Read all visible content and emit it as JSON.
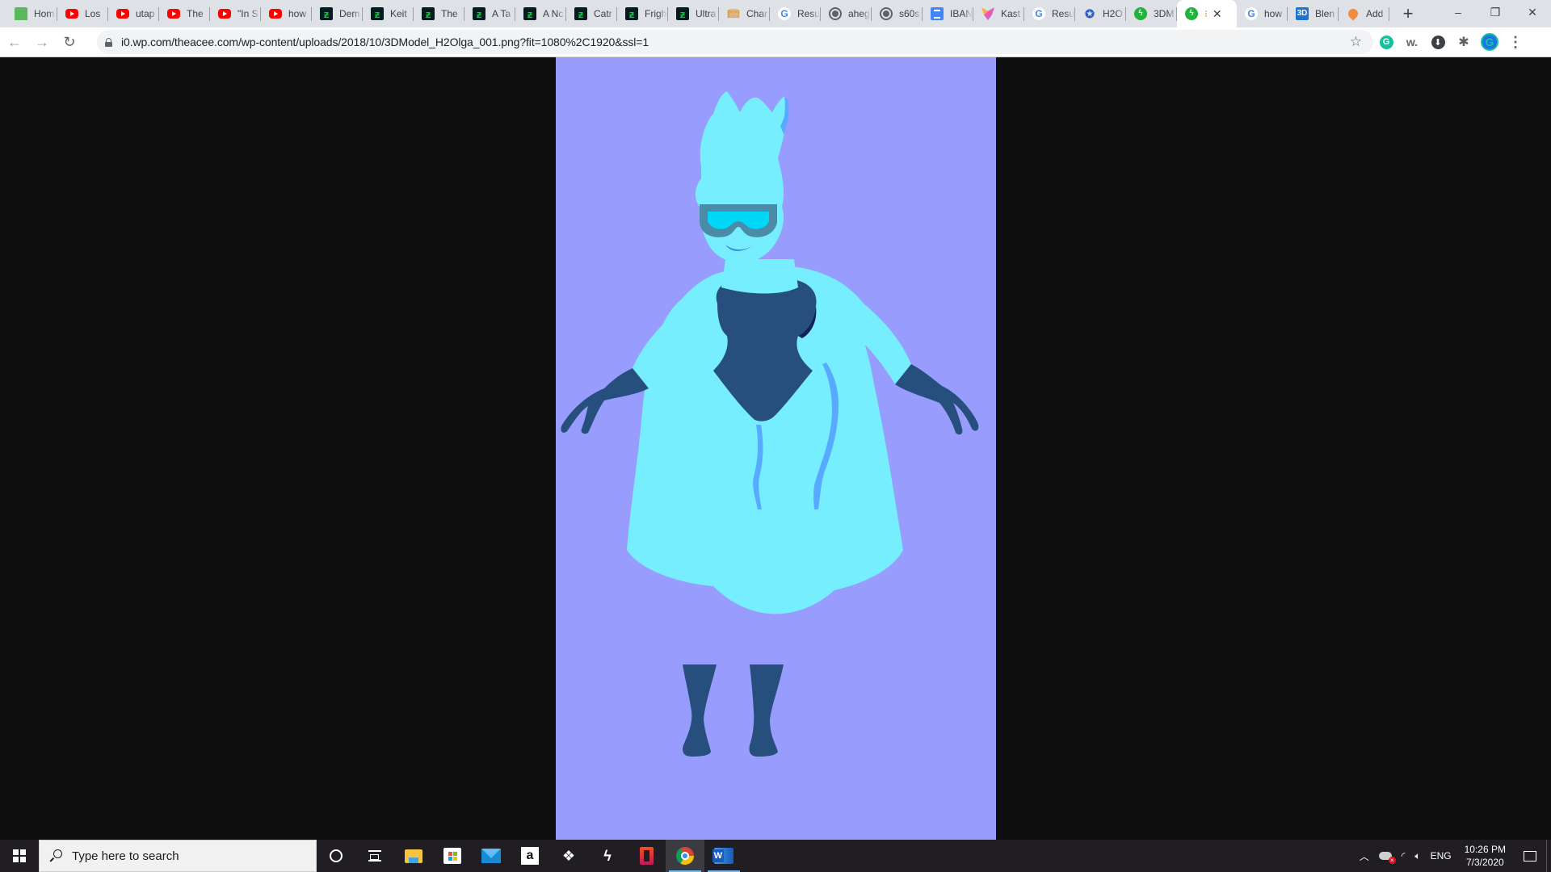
{
  "browser": {
    "tabs": [
      {
        "favicon": "home-icon",
        "title": "Hom"
      },
      {
        "favicon": "youtube-icon",
        "title": "Los"
      },
      {
        "favicon": "youtube-icon",
        "title": "utap"
      },
      {
        "favicon": "youtube-icon",
        "title": "The"
      },
      {
        "favicon": "youtube-icon",
        "title": "\"In S"
      },
      {
        "favicon": "youtube-icon",
        "title": "how"
      },
      {
        "favicon": "deviantart-icon",
        "title": "Dem"
      },
      {
        "favicon": "deviantart-icon",
        "title": "Keit"
      },
      {
        "favicon": "deviantart-icon",
        "title": "The"
      },
      {
        "favicon": "deviantart-icon",
        "title": "A Ta"
      },
      {
        "favicon": "deviantart-icon",
        "title": "A Nc"
      },
      {
        "favicon": "deviantart-icon",
        "title": "Catr"
      },
      {
        "favicon": "deviantart-icon",
        "title": "Frigh"
      },
      {
        "favicon": "deviantart-icon",
        "title": "Ultra"
      },
      {
        "favicon": "book-icon",
        "title": "Char"
      },
      {
        "favicon": "google-icon",
        "title": "Resu"
      },
      {
        "favicon": "globe-icon",
        "title": "aheg"
      },
      {
        "favicon": "globe-icon",
        "title": "s60s"
      },
      {
        "favicon": "docs-icon",
        "title": "IBAN"
      },
      {
        "favicon": "kast-icon",
        "title": "Kast"
      },
      {
        "favicon": "google-icon",
        "title": "Resu"
      },
      {
        "favicon": "h2o-icon",
        "title": "H2O"
      },
      {
        "favicon": "green-bolt-icon",
        "title": "3DM"
      },
      {
        "favicon": "green-bolt-icon",
        "title": "",
        "active": true
      },
      {
        "favicon": "google-icon",
        "title": "how"
      },
      {
        "favicon": "3d-icon",
        "title": "Blen"
      },
      {
        "favicon": "pin-icon",
        "title": "Add"
      }
    ],
    "new_tab_label": "+",
    "window_controls": {
      "minimize": "–",
      "restore": "❐",
      "close": "✕"
    },
    "address_bar": {
      "url": "i0.wp.com/theacee.com/wp-content/uploads/2018/10/3DModel_H2Olga_001.png?fit=1080%2C1920&ssl=1"
    },
    "extensions": [
      "grammarly-icon",
      "w-extension-icon",
      "download-icon",
      "extensions-puzzle-icon",
      "profile-avatar-icon",
      "menu-icon"
    ]
  },
  "image": {
    "description": "3D model H2Olga — cyan superhero character with goggles, dark blue leotard, gloves, boots and cape",
    "colors": {
      "background": "#979cfd",
      "skin": "#77eefe",
      "shadow": "#57aaff",
      "suit": "#264f7d",
      "suit_shadow": "#14205a",
      "goggle_frame": "#4a8ca8",
      "goggle_lens": "#00d7f7",
      "mouth": "#3d8ee0"
    }
  },
  "taskbar": {
    "search_placeholder": "Type here to search",
    "pinned": [
      "file-explorer",
      "microsoft-store",
      "mail",
      "amazon",
      "dropbox",
      "bolt-app",
      "office",
      "chrome",
      "word"
    ],
    "tray": {
      "language": "ENG",
      "time": "10:26 PM",
      "date": "7/3/2020"
    }
  }
}
